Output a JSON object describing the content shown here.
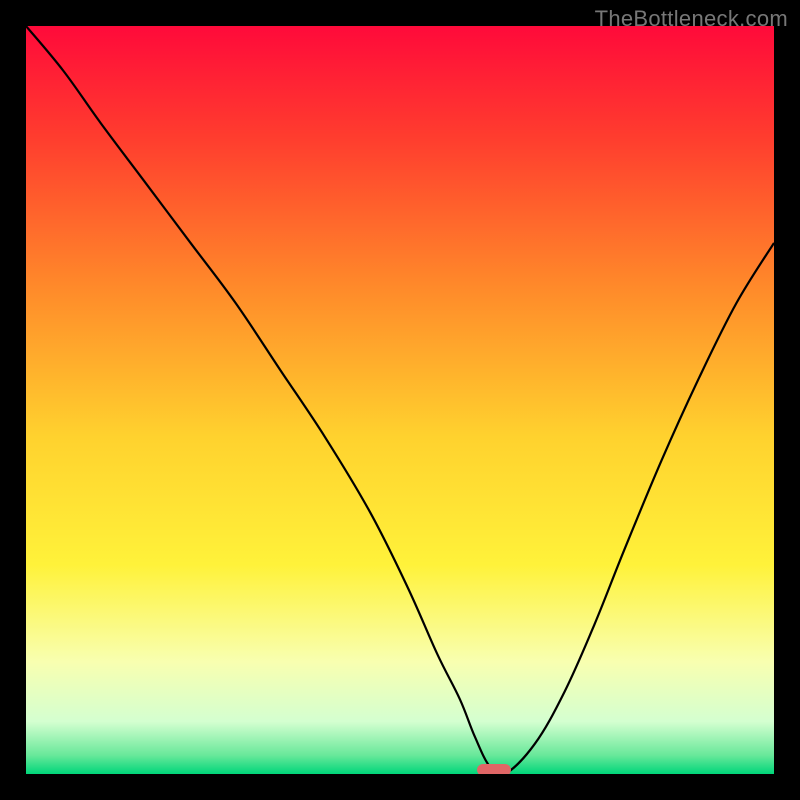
{
  "watermark": "TheBottleneck.com",
  "colors": {
    "frame_bg": "#000000",
    "curve_stroke": "#000000",
    "marker_fill": "#e06666",
    "watermark_text": "#777777"
  },
  "chart_data": {
    "type": "line",
    "title": "",
    "xlabel": "",
    "ylabel": "",
    "xlim": [
      0,
      100
    ],
    "ylim": [
      0,
      100
    ],
    "gradient_stops": [
      {
        "pos": 0.0,
        "color": "#ff0a3a"
      },
      {
        "pos": 0.15,
        "color": "#ff3d2e"
      },
      {
        "pos": 0.35,
        "color": "#ff8a2a"
      },
      {
        "pos": 0.55,
        "color": "#ffd22e"
      },
      {
        "pos": 0.72,
        "color": "#fff23a"
      },
      {
        "pos": 0.85,
        "color": "#f8ffb0"
      },
      {
        "pos": 0.93,
        "color": "#d4ffd0"
      },
      {
        "pos": 0.975,
        "color": "#68e89a"
      },
      {
        "pos": 1.0,
        "color": "#00d67a"
      }
    ],
    "series": [
      {
        "name": "bottleneck-curve",
        "x": [
          0,
          5,
          10,
          16,
          22,
          28,
          34,
          40,
          46,
          51,
          55,
          58,
          60,
          62,
          64,
          68,
          72,
          76,
          80,
          85,
          90,
          95,
          100
        ],
        "y": [
          100,
          94,
          87,
          79,
          71,
          63,
          54,
          45,
          35,
          25,
          16,
          10,
          5,
          1,
          0,
          4,
          11,
          20,
          30,
          42,
          53,
          63,
          71
        ]
      }
    ],
    "marker": {
      "x": 62.5,
      "y": 0.5
    }
  }
}
